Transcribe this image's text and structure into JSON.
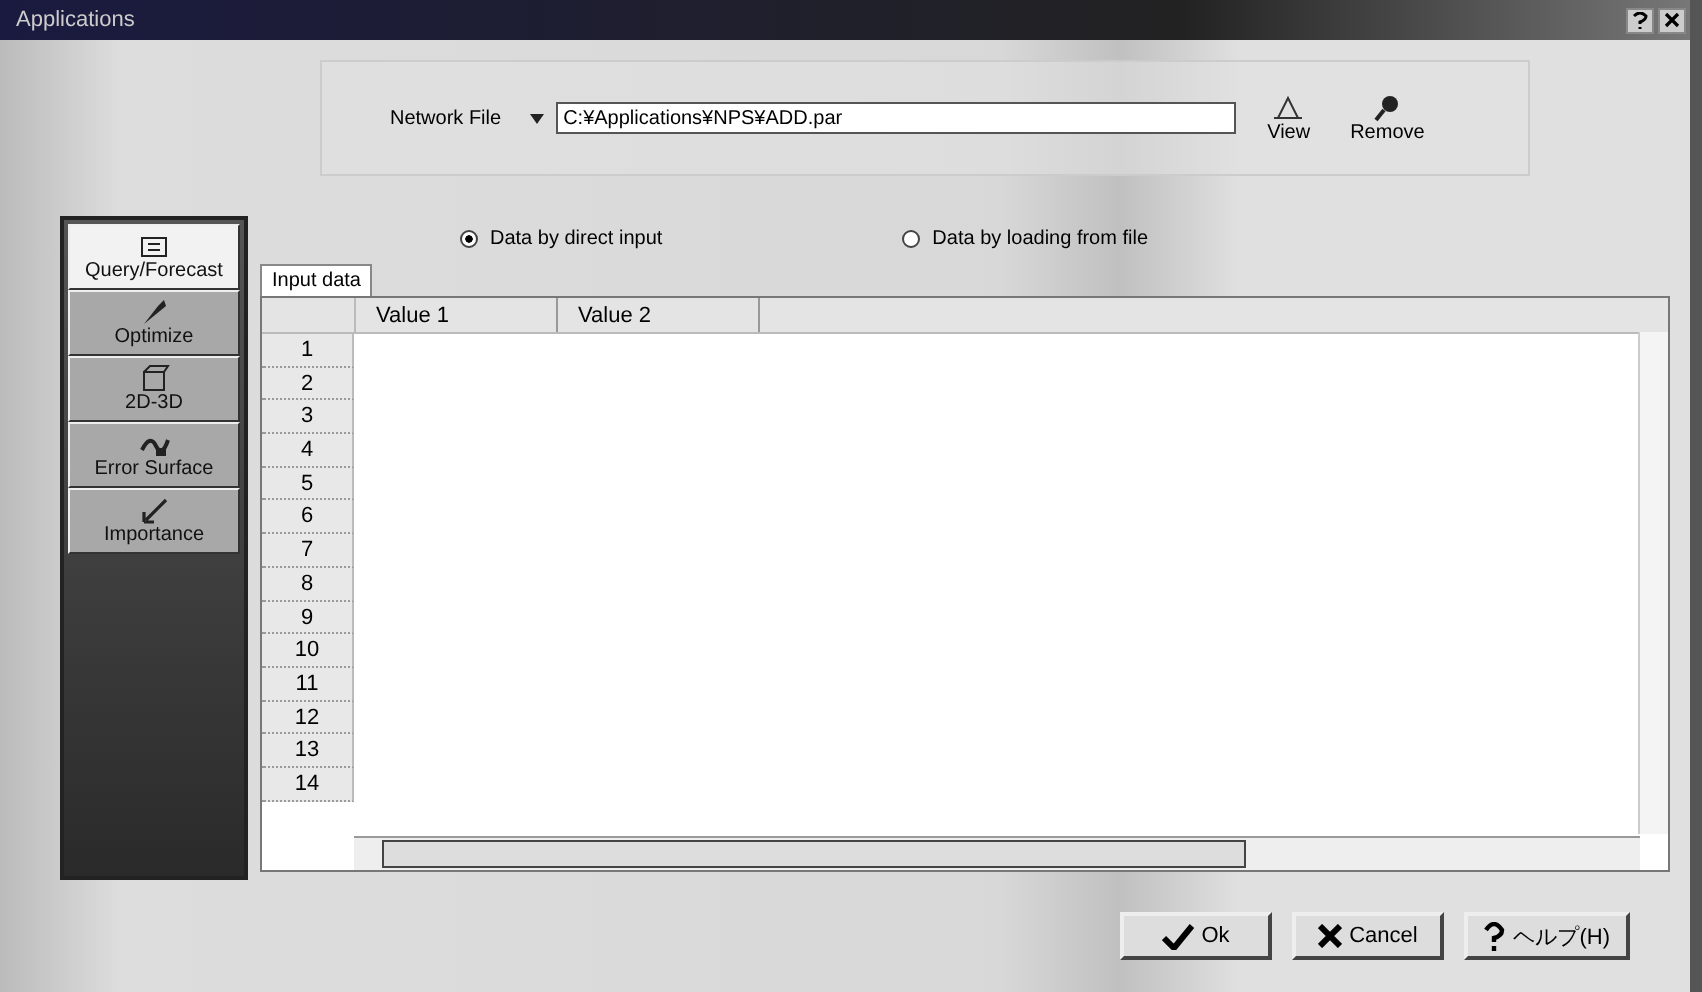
{
  "window": {
    "title": "Applications"
  },
  "toolbar": {
    "network_file_label": "Network File",
    "path": "C:¥Applications¥NPS¥ADD.par",
    "buttons": [
      {
        "label": "View",
        "kind": "view"
      },
      {
        "label": "Remove",
        "kind": "remove"
      }
    ]
  },
  "sidebar": {
    "items": [
      {
        "label": "Query/Forecast",
        "selected": true
      },
      {
        "label": "Optimize",
        "selected": false
      },
      {
        "label": "2D-3D",
        "selected": false
      },
      {
        "label": "Error Surface",
        "selected": false
      },
      {
        "label": "Importance",
        "selected": false
      }
    ]
  },
  "input_mode": [
    {
      "label": "Data by direct input",
      "selected": true
    },
    {
      "label": "Data by loading from file",
      "selected": false
    }
  ],
  "tabs": [
    {
      "label": "Input data",
      "selected": true
    }
  ],
  "table": {
    "columns": [
      "Value 1",
      "Value 2"
    ],
    "rows": [
      "1",
      "2",
      "3",
      "4",
      "5",
      "6",
      "7",
      "8",
      "9",
      "10",
      "11",
      "12",
      "13",
      "14"
    ]
  },
  "buttons": [
    {
      "label": "Ok",
      "kind": "ok"
    },
    {
      "label": "Cancel",
      "kind": "cancel"
    },
    {
      "label": "ヘルプ(H)",
      "kind": "help"
    }
  ]
}
